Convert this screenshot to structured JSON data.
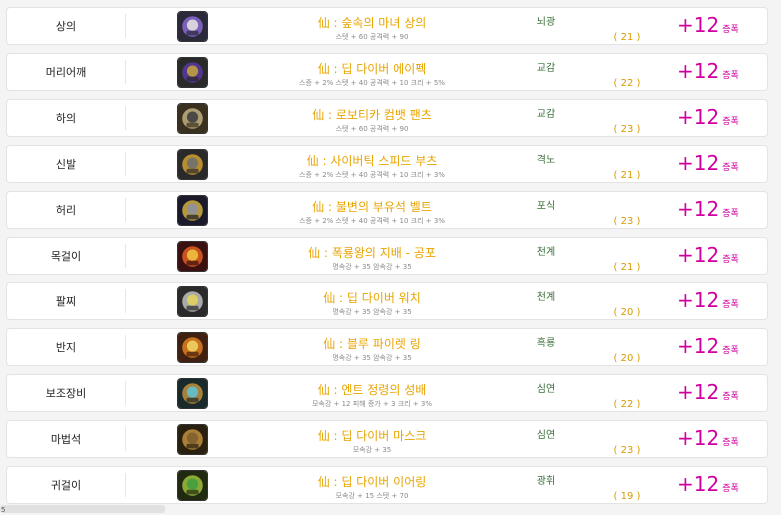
{
  "enhance_label": "증폭",
  "rows": [
    {
      "slot": "상의",
      "name": "仙 : 숲속의 마녀 상의",
      "stats": "스텟 + 60 공격력 + 90",
      "extra": "뇌광",
      "level": "( 21 )",
      "enh": "+12",
      "icon_colors": [
        "#2a2a3a",
        "#8a6ad0",
        "#e0e0e0"
      ]
    },
    {
      "slot": "머리어깨",
      "name": "仙 : 딥 다이버 에이펙",
      "stats": "스증 + 2% 스텟 + 40 공격력 + 10 크리 + 5%",
      "extra": "교감",
      "level": "( 22 )",
      "enh": "+12",
      "icon_colors": [
        "#2a2a2a",
        "#5a3aa0",
        "#c0a040"
      ]
    },
    {
      "slot": "하의",
      "name": "仙 : 로보티카 컴뱃 팬츠",
      "stats": "스텟 + 60 공격력 + 90",
      "extra": "교감",
      "level": "( 23 )",
      "enh": "+12",
      "icon_colors": [
        "#3a3020",
        "#c0b080",
        "#404040"
      ]
    },
    {
      "slot": "신발",
      "name": "仙 : 사이버틱 스피드 부츠",
      "stats": "스증 + 2% 스텟 + 40 공격력 + 10 크리 + 3%",
      "extra": "격노",
      "level": "( 21 )",
      "enh": "+12",
      "icon_colors": [
        "#2a2a2a",
        "#d0a030",
        "#707070"
      ]
    },
    {
      "slot": "허리",
      "name": "仙 : 불변의 부유석 벨트",
      "stats": "스증 + 2% 스텟 + 40 공격력 + 10 크리 + 3%",
      "extra": "포식",
      "level": "( 23 )",
      "enh": "+12",
      "icon_colors": [
        "#1a1a2a",
        "#d0b040",
        "#9090a0"
      ]
    },
    {
      "slot": "목걸이",
      "name": "仙 : 폭룡왕의 지배 - 공포",
      "stats": "명속강 + 35 암속강 + 35",
      "extra": "천계",
      "level": "( 21 )",
      "enh": "+12",
      "icon_colors": [
        "#3a1010",
        "#e06020",
        "#f0c040"
      ]
    },
    {
      "slot": "팔찌",
      "name": "仙 : 딥 다이버 워치",
      "stats": "명속강 + 35 암속강 + 35",
      "extra": "천계",
      "level": "( 20 )",
      "enh": "+12",
      "icon_colors": [
        "#2a2a2a",
        "#c0c0c0",
        "#e0d060"
      ]
    },
    {
      "slot": "반지",
      "name": "仙 : 블루 파이렛 링",
      "stats": "명속강 + 35 암속강 + 35",
      "extra": "흑룡",
      "level": "( 20 )",
      "enh": "+12",
      "icon_colors": [
        "#402010",
        "#e08020",
        "#f0d060"
      ]
    },
    {
      "slot": "보조장비",
      "name": "仙 : 엔트 정령의 성배",
      "stats": "모속강 + 12 피해 증가 + 3 크리 + 3%",
      "extra": "심연",
      "level": "( 22 )",
      "enh": "+12",
      "icon_colors": [
        "#1a2a2a",
        "#c09040",
        "#60c0d0"
      ]
    },
    {
      "slot": "마법석",
      "name": "仙 : 딥 다이버 마스크",
      "stats": "모속강 + 35",
      "extra": "심연",
      "level": "( 23 )",
      "enh": "+12",
      "icon_colors": [
        "#2a2010",
        "#c09040",
        "#806030"
      ]
    },
    {
      "slot": "귀걸이",
      "name": "仙 : 딥 다이버 이어링",
      "stats": "모속강 + 15 스텟 + 70",
      "extra": "광휘",
      "level": "( 19 )",
      "enh": "+12",
      "icon_colors": [
        "#202a10",
        "#a0c040",
        "#40a040"
      ]
    }
  ],
  "footer_glyph": "5"
}
